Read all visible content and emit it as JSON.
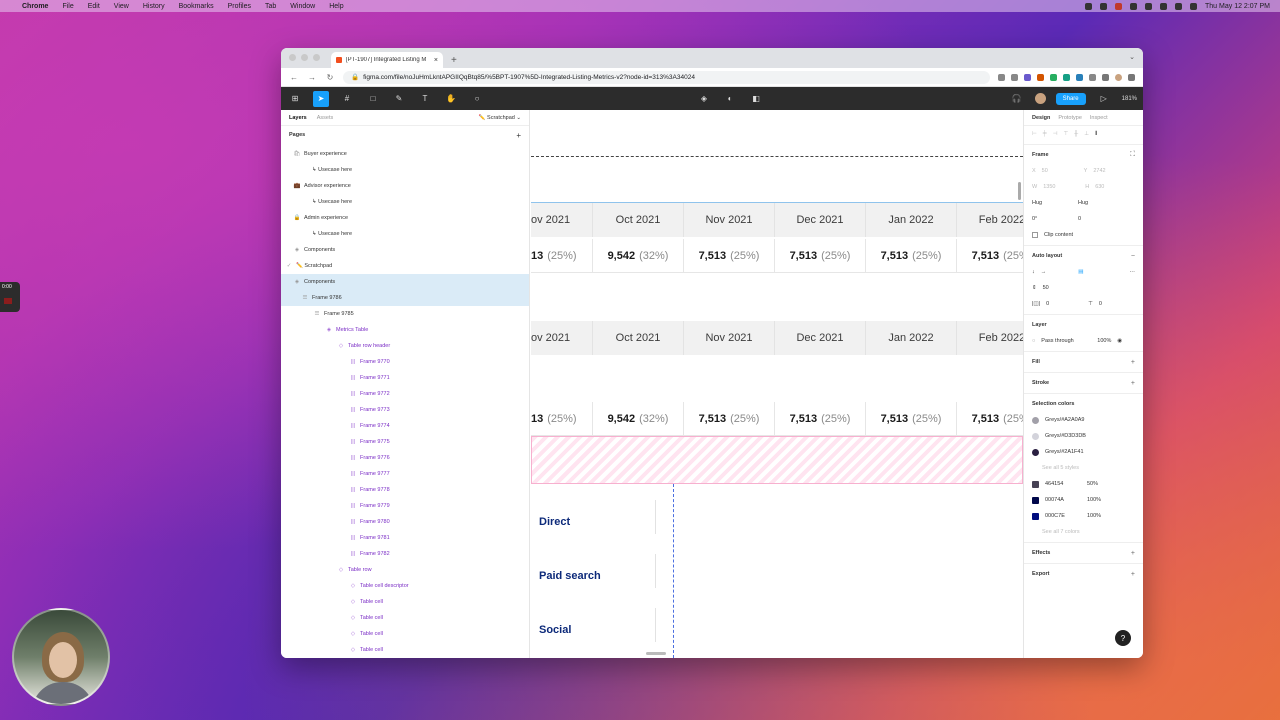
{
  "menubar": {
    "app": "Chrome",
    "items": [
      "File",
      "Edit",
      "View",
      "History",
      "Bookmarks",
      "Profiles",
      "Tab",
      "Window",
      "Help"
    ],
    "clock": "Thu May 12  2:07 PM"
  },
  "timer": {
    "label": "0:00"
  },
  "browser": {
    "tab_title": "[PT-1907] Integrated Listing M",
    "url": "figma.com/file/noJuHmLkntAPGIIQqBtq85/%5BPT-1907%5D-Integrated-Listing-Metrics-v2?node-id=313%3A34024"
  },
  "figma": {
    "share_label": "Share",
    "zoom": "181%",
    "layers_panel": {
      "tab_layers": "Layers",
      "tab_assets": "Assets",
      "scratchpad": "✏️ Scratchpad ⌄",
      "pages_label": "Pages",
      "rows": [
        {
          "label": "Buyer experience",
          "icon": "🛍",
          "indent": 12,
          "style": "normal"
        },
        {
          "label": "↳ Usecase here",
          "icon": "",
          "indent": 20,
          "style": "normal"
        },
        {
          "label": "Advisor experience",
          "icon": "💼",
          "indent": 12,
          "style": "normal"
        },
        {
          "label": "↳ Usecase here",
          "icon": "",
          "indent": 20,
          "style": "normal"
        },
        {
          "label": "Admin experience",
          "icon": "🔒",
          "indent": 12,
          "style": "normal"
        },
        {
          "label": "↳ Usecase here",
          "icon": "",
          "indent": 20,
          "style": "normal"
        },
        {
          "label": "Components",
          "icon": "◈",
          "indent": 12,
          "style": "normal"
        },
        {
          "label": "✏️ Scratchpad",
          "icon": "✓",
          "indent": 4,
          "style": "normal"
        },
        {
          "label": "Components",
          "icon": "◈",
          "indent": 12,
          "style": "selected"
        },
        {
          "label": "Frame 9786",
          "icon": "☰",
          "indent": 20,
          "style": "selected"
        },
        {
          "label": "Frame 9785",
          "icon": "☰",
          "indent": 32,
          "style": "normal"
        },
        {
          "label": "Metrics Table",
          "icon": "◈",
          "indent": 44,
          "style": "purple"
        },
        {
          "label": "Table row header",
          "icon": "◇",
          "indent": 56,
          "style": "purple"
        },
        {
          "label": "Frame 9770",
          "icon": "|||",
          "indent": 68,
          "style": "purple"
        },
        {
          "label": "Frame 9771",
          "icon": "|||",
          "indent": 68,
          "style": "purple"
        },
        {
          "label": "Frame 9772",
          "icon": "|||",
          "indent": 68,
          "style": "purple"
        },
        {
          "label": "Frame 9773",
          "icon": "|||",
          "indent": 68,
          "style": "purple"
        },
        {
          "label": "Frame 9774",
          "icon": "|||",
          "indent": 68,
          "style": "purple"
        },
        {
          "label": "Frame 9775",
          "icon": "|||",
          "indent": 68,
          "style": "purple"
        },
        {
          "label": "Frame 9776",
          "icon": "|||",
          "indent": 68,
          "style": "purple"
        },
        {
          "label": "Frame 9777",
          "icon": "|||",
          "indent": 68,
          "style": "purple"
        },
        {
          "label": "Frame 9778",
          "icon": "|||",
          "indent": 68,
          "style": "purple"
        },
        {
          "label": "Frame 9779",
          "icon": "|||",
          "indent": 68,
          "style": "purple"
        },
        {
          "label": "Frame 9780",
          "icon": "|||",
          "indent": 68,
          "style": "purple"
        },
        {
          "label": "Frame 9781",
          "icon": "|||",
          "indent": 68,
          "style": "purple"
        },
        {
          "label": "Frame 9782",
          "icon": "|||",
          "indent": 68,
          "style": "purple"
        },
        {
          "label": "Table row",
          "icon": "◇",
          "indent": 56,
          "style": "purple"
        },
        {
          "label": "Table cell descriptor",
          "icon": "◇",
          "indent": 68,
          "style": "purple"
        },
        {
          "label": "Table cell",
          "icon": "◇",
          "indent": 68,
          "style": "purple"
        },
        {
          "label": "Table cell",
          "icon": "◇",
          "indent": 68,
          "style": "purple"
        },
        {
          "label": "Table cell",
          "icon": "◇",
          "indent": 68,
          "style": "purple"
        },
        {
          "label": "Table cell",
          "icon": "◇",
          "indent": 68,
          "style": "purple"
        }
      ]
    },
    "canvas": {
      "months": [
        "ov 2021",
        "Oct 2021",
        "Nov 2021",
        "Dec 2021",
        "Jan 2022",
        "Feb 2022"
      ],
      "row1": [
        [
          "13",
          "(25%)"
        ],
        [
          "9,542",
          "(32%)"
        ],
        [
          "7,513",
          "(25%)"
        ],
        [
          "7,513",
          "(25%)"
        ],
        [
          "7,513",
          "(25%)"
        ],
        [
          "7,513",
          "(25%)"
        ]
      ],
      "row2": [
        [
          "13",
          "(25%)"
        ],
        [
          "9,542",
          "(32%)"
        ],
        [
          "7,513",
          "(25%)"
        ],
        [
          "7,513",
          "(25%)"
        ],
        [
          "7,513",
          "(25%)"
        ],
        [
          "7,513",
          "(25%)"
        ]
      ],
      "channels": [
        "Direct",
        "Paid search",
        "Social"
      ]
    },
    "design_panel": {
      "tab_design": "Design",
      "tab_prototype": "Prototype",
      "tab_inspect": "Inspect",
      "frame_label": "Frame",
      "x": "50",
      "y": "2742",
      "w": "1350",
      "h": "630",
      "hug_w": "Hug",
      "hug_h": "Hug",
      "rotation": "0°",
      "radius": "0",
      "clip_content": "Clip content",
      "auto_layout": "Auto layout",
      "spacing": "50",
      "padding_h": "0",
      "padding_v": "0",
      "layer_label": "Layer",
      "blend": "Pass through",
      "opacity": "100%",
      "fill_label": "Fill",
      "stroke_label": "Stroke",
      "selection_colors_label": "Selection colors",
      "colors": [
        {
          "name": "Greys/#A2A0A9",
          "hex": "#A2A0A9"
        },
        {
          "name": "Greys/#D3D3DB",
          "hex": "#D3D3DB"
        },
        {
          "name": "Greys/#2A1F41",
          "hex": "#2A1F41"
        }
      ],
      "see_styles": "See all 5 styles",
      "raw_colors": [
        {
          "name": "464154",
          "pct": "50%",
          "hex": "#464154"
        },
        {
          "name": "00074A",
          "pct": "100%",
          "hex": "#00074A"
        },
        {
          "name": "000C7E",
          "pct": "100%",
          "hex": "#000C7E"
        }
      ],
      "see_colors": "See all 7 colors",
      "effects_label": "Effects",
      "export_label": "Export"
    }
  }
}
